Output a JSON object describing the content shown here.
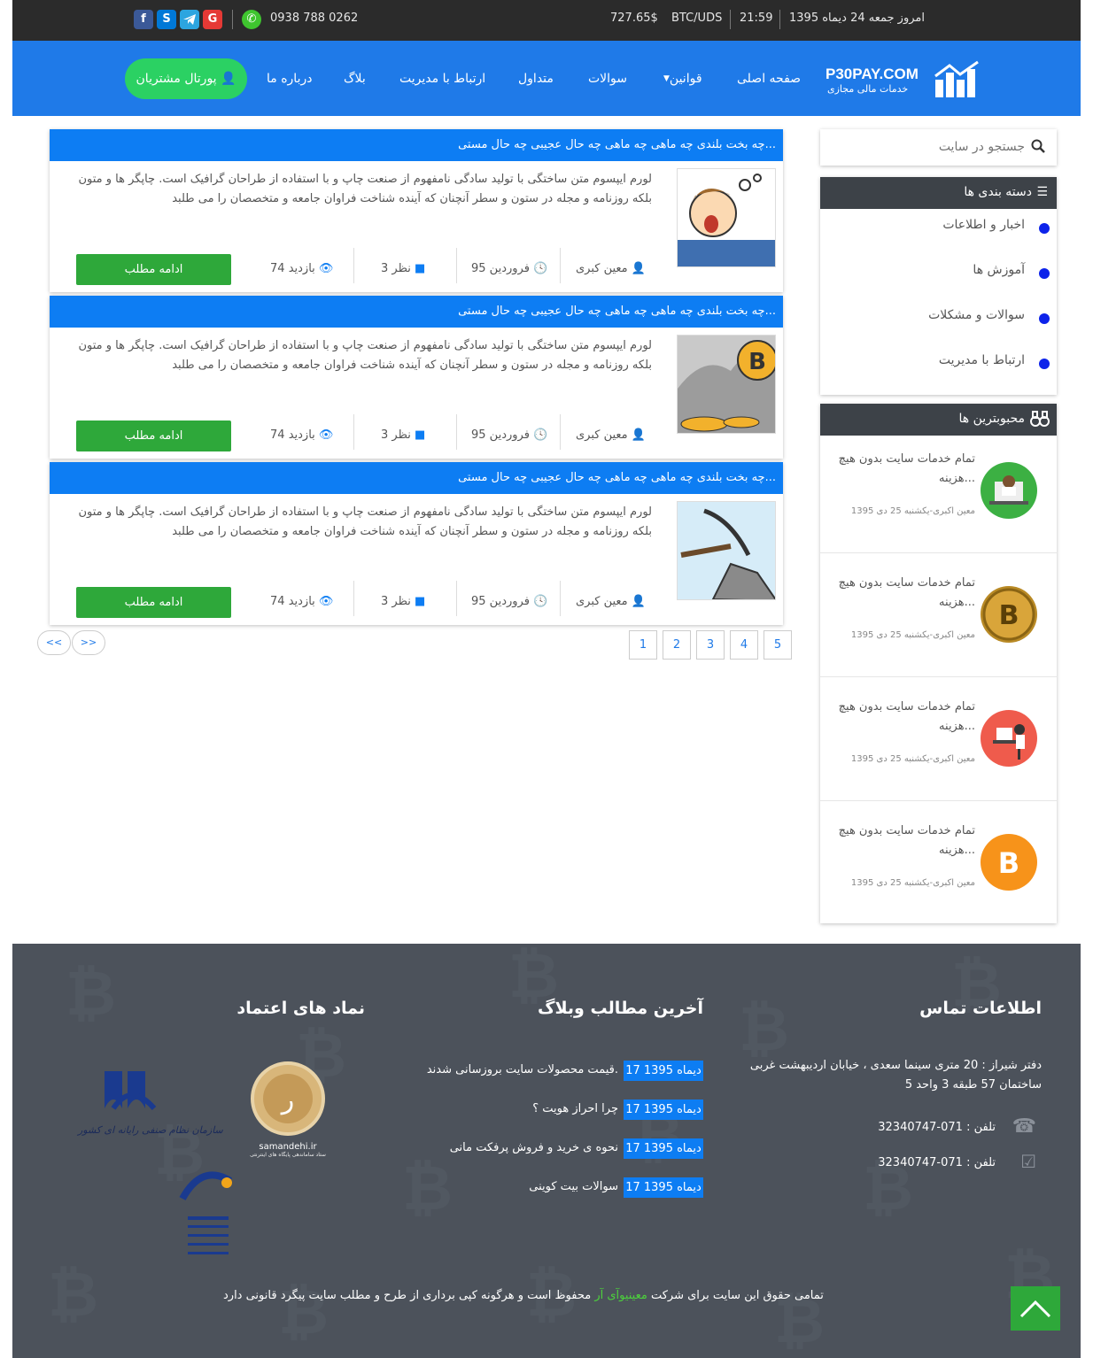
{
  "topbar": {
    "date": "امروز جمعه 24 دیماه 1395",
    "time": "21:59",
    "pair": "BTC/UDS",
    "price": "727.65$",
    "phone": "0938 788 0262",
    "social_icons": [
      "google-icon",
      "telegram-icon",
      "skype-icon",
      "facebook-icon"
    ],
    "colors": {
      "google": "#e53935",
      "telegram": "#2ca5e0",
      "skype": "#0078d7",
      "facebook": "#3b5998",
      "phone": "#3fc52f"
    }
  },
  "logo": {
    "title": "P30PAY.COM",
    "subtitle": "خدمات مالی مجازی"
  },
  "nav": {
    "items": [
      "صفحه اصلی",
      "قوانین",
      "سوالات",
      "متداول",
      "ارتباط با مدیریت",
      "بلاگ",
      "درباره ما"
    ],
    "portal": "پورتال مشتریان",
    "color": "#1f7ae8"
  },
  "sidebar": {
    "search_placeholder": "جستجو در سایت",
    "categories_title": "دسته بندی ها",
    "categories": [
      "اخبار و اطلاعات",
      "آموزش ها",
      "سوالات و مشکلات",
      "ارتباط با مدیریت"
    ],
    "popular_title": "محبوبترین ها",
    "popular": [
      {
        "title": "تمام خدمات سایت بدون هیچ هزینه...",
        "meta": "معین اکبری-یکشنبه 25 دی 1395",
        "image": "computer-user-icon"
      },
      {
        "title": "تمام خدمات سایت بدون هیچ هزینه...",
        "meta": "معین اکبری-یکشنبه 25 دی 1395",
        "image": "bitcoin-coin-icon"
      },
      {
        "title": "تمام خدمات سایت بدون هیچ هزینه...",
        "meta": "معین اکبری-یکشنبه 25 دی 1395",
        "image": "desk-worker-icon"
      },
      {
        "title": "تمام خدمات سایت بدون هیچ هزینه...",
        "meta": "معین اکبری-یکشنبه 25 دی 1395",
        "image": "bitcoin-orange-icon"
      }
    ]
  },
  "posts": [
    {
      "title": "چه بخت بلندی چه ماهی چه ماهی چه حال عجیبی چه حال مستی...",
      "excerpt": "لورم ایپسوم متن ساختگی با تولید سادگی نامفهوم از صنعت چاپ و با استفاده از طراحان گرافیک است. چاپگر ها و متون بلکه روزنامه و مجله در ستون و سطر آنچنان که آینده شناخت فراوان جامعه و متخصصان را می طلبد",
      "author": "معین کبری",
      "date": "فروردین 95",
      "comments": "3 نظر",
      "views": "74 بازدید",
      "button": "ادامه مطلب",
      "image": "cartoon-boy-image"
    },
    {
      "title": "چه بخت بلندی چه ماهی چه ماهی چه حال عجیبی چه حال مستی...",
      "excerpt": "لورم ایپسوم متن ساختگی با تولید سادگی نامفهوم از صنعت چاپ و با استفاده از طراحان گرافیک است. چاپگر ها و متون بلکه روزنامه و مجله در ستون و سطر آنچنان که آینده شناخت فراوان جامعه و متخصصان را می طلبد",
      "author": "معین کبری",
      "date": "فروردین 95",
      "comments": "3 نظر",
      "views": "74 بازدید",
      "button": "ادامه مطلب",
      "image": "bitcoin-mine-image"
    },
    {
      "title": "چه بخت بلندی چه ماهی چه ماهی چه حال عجیبی چه حال مستی...",
      "excerpt": "لورم ایپسوم متن ساختگی با تولید سادگی نامفهوم از صنعت چاپ و با استفاده از طراحان گرافیک است. چاپگر ها و متون بلکه روزنامه و مجله در ستون و سطر آنچنان که آینده شناخت فراوان جامعه و متخصصان را می طلبد",
      "author": "معین کبری",
      "date": "فروردین 95",
      "comments": "3 نظر",
      "views": "74 بازدید",
      "button": "ادامه مطلب",
      "image": "pickaxe-image"
    }
  ],
  "pagination": {
    "pages": [
      "5",
      "4",
      "3",
      "2",
      "1"
    ],
    "next": ">>",
    "prev": "<<"
  },
  "footer": {
    "contact_title": "اطلاعات تماس",
    "address_line1": "دفتر شیراز : 20 متری سینما سعدی ، خیابان اردیبهشت غربی",
    "address_line2": "ساختمان 57 طبقه 3 واحد 5",
    "phone1": "تلفن : 071-32340747",
    "phone2": "تلفن : 071-32340747",
    "blog_title": "آخرین مطالب وبلاگ",
    "blog_posts": [
      {
        "date": "17 دیماه 1395",
        "title": "قیمت محصولات سایت بروزسانی شدند."
      },
      {
        "date": "17 دیماه 1395",
        "title": "چرا احراز هویت ؟"
      },
      {
        "date": "17 دیماه 1395",
        "title": "نحوه ی خرید و فروش پرفکت مانی"
      },
      {
        "date": "17 دیماه 1395",
        "title": "سوالات بیت کوینی"
      }
    ],
    "trust_title": "نماد های اعتماد",
    "samandehi": "samandehi.ir",
    "samandehi_caption": "ستاد ساماندهی پایگاه های اینترنتی",
    "nezam_caption": "سازمان نظام صنفی رایانه ای کشور",
    "copyright_pre": "تمامی حقوق این سایت برای شرکت ",
    "copyright_link": "معینیوآی آر",
    "copyright_post": " محفوظ است و هرگونه کپی برداری از طرح و مطلب سایت پیگرد قانونی دارد"
  }
}
